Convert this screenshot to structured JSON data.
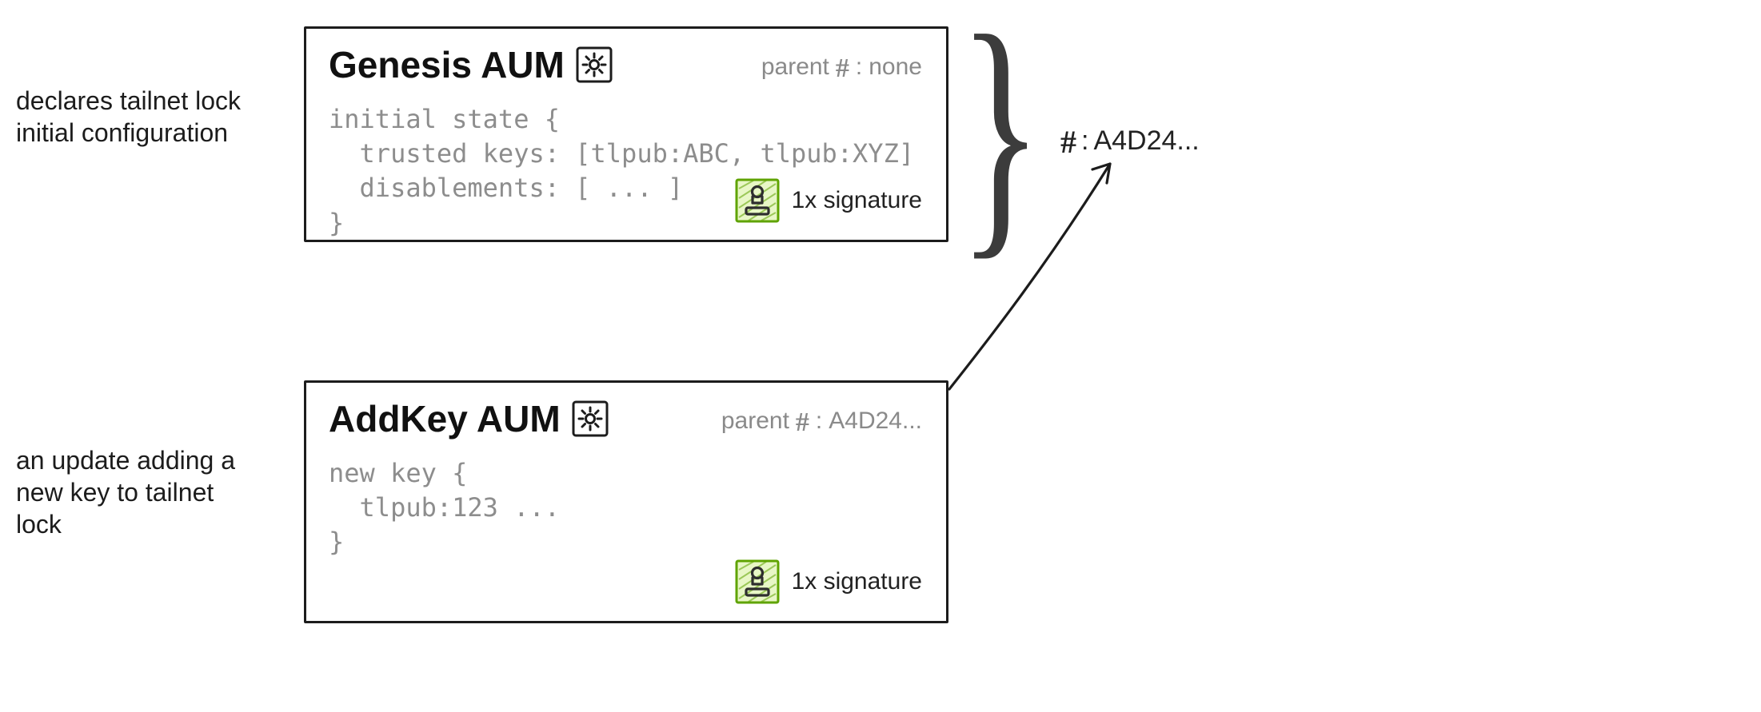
{
  "notes": {
    "genesis": "declares tailnet lock\ninitial configuration",
    "addkey": "an update adding a\nnew key to tailnet\nlock"
  },
  "genesis": {
    "title": "Genesis AUM",
    "parent_prefix": "parent",
    "parent_value": "none",
    "code": "initial state {\n  trusted keys: [tlpub:ABC, tlpub:XYZ]\n  disablements: [ ... ]\n}",
    "signature_label": "1x signature"
  },
  "addkey": {
    "title": "AddKey AUM",
    "parent_prefix": "parent",
    "parent_value": "A4D24...",
    "code": "new key {\n  tlpub:123 ...\n}",
    "signature_label": "1x signature"
  },
  "hash_result": {
    "prefix": "",
    "value": "A4D24..."
  }
}
